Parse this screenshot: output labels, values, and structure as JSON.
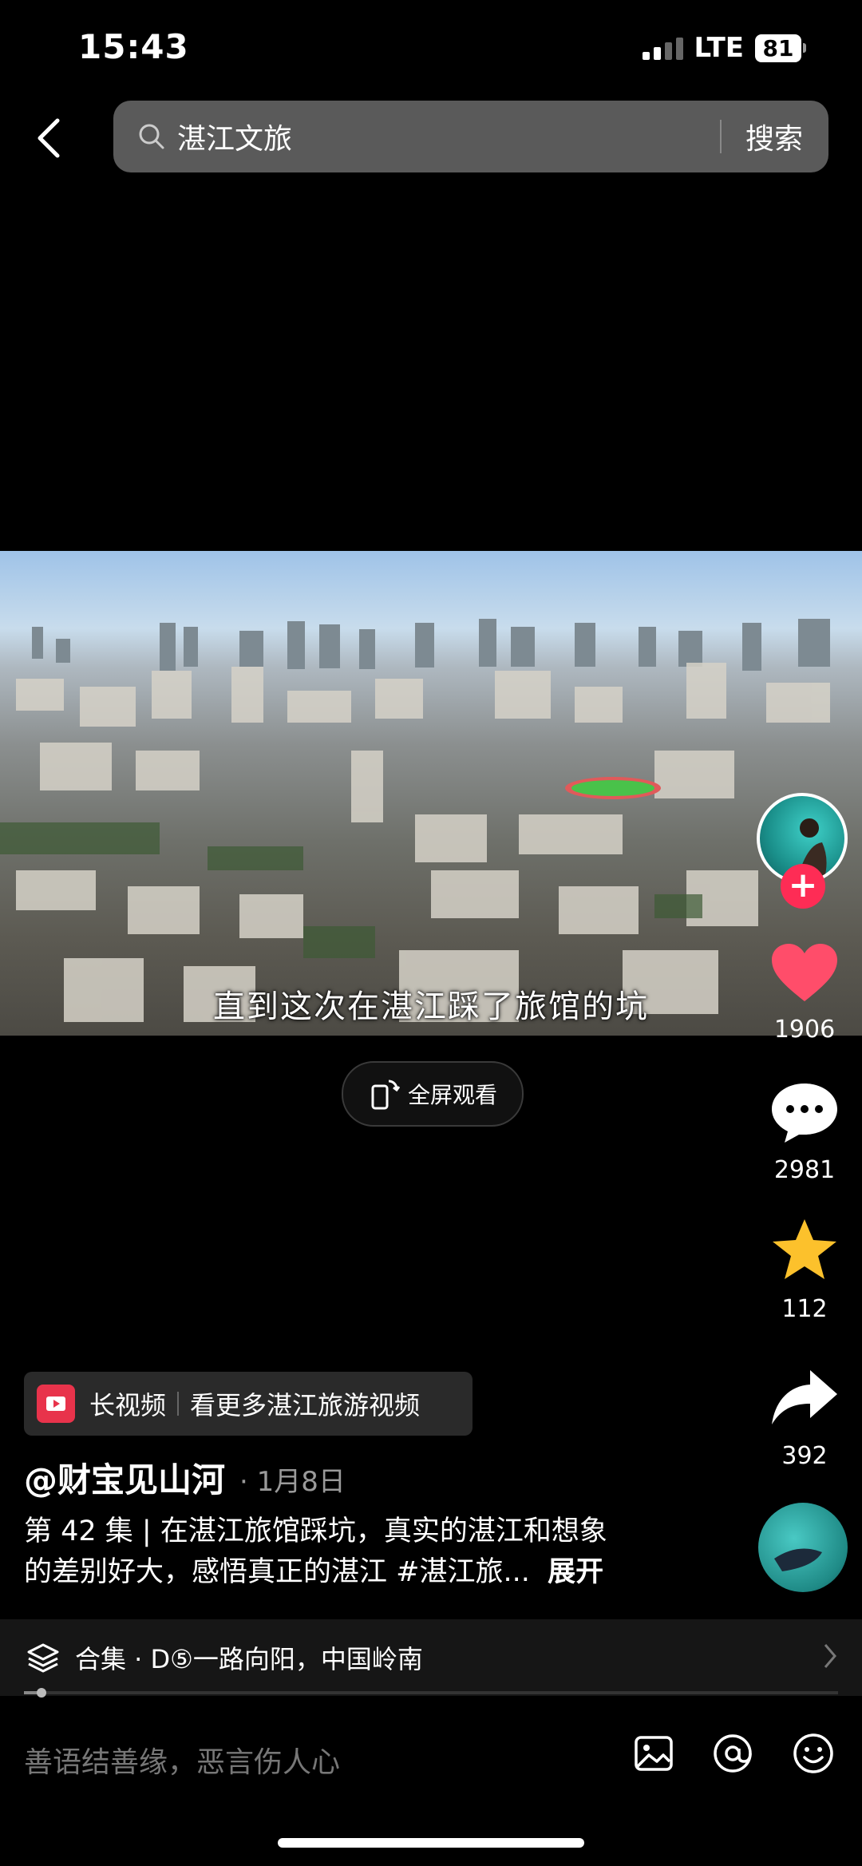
{
  "status": {
    "time": "15:43",
    "network": "LTE",
    "battery": "81"
  },
  "search": {
    "query": "湛江文旅",
    "button": "搜索"
  },
  "video": {
    "subtitle": "直到这次在湛江踩了旅馆的坑",
    "fullscreen_label": "全屏观看"
  },
  "actions": {
    "likes": "1906",
    "comments": "2981",
    "favorites": "112",
    "shares": "392"
  },
  "long_video": {
    "label": "长视频",
    "text": "看更多湛江旅游视频"
  },
  "post": {
    "author": "@财宝见山河",
    "date": "· 1月8日",
    "description_line1": "第 42 集 | 在湛江旅馆踩坑，真实的湛江和想象",
    "description_line2": "的差别好大，感悟真正的湛江 #湛江旅...",
    "expand": "展开"
  },
  "collection": {
    "text": "合集 · D⑤一路向阳，中国岭南"
  },
  "comment": {
    "placeholder": "善语结善缘，恶言伤人心"
  },
  "colors": {
    "accent": "#fe2c55",
    "star": "#fcc12c",
    "like": "#ff4d6a"
  },
  "icons": [
    "back-icon",
    "search-icon",
    "plus-icon",
    "heart-icon",
    "comment-icon",
    "star-icon",
    "share-icon",
    "layers-icon",
    "chevron-right-icon",
    "image-icon",
    "at-icon",
    "emoji-icon"
  ]
}
